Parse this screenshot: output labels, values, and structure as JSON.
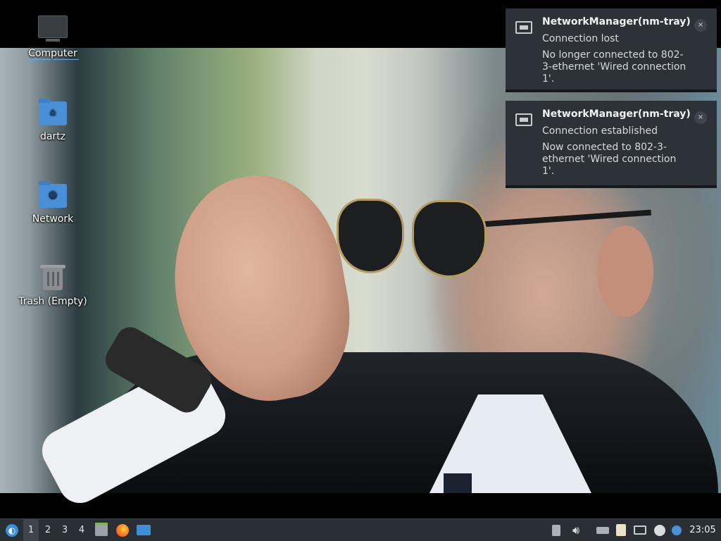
{
  "desktop": {
    "icons": [
      {
        "label": "Computer",
        "icon": "computer-icon"
      },
      {
        "label": "dartz",
        "icon": "home-folder-icon"
      },
      {
        "label": "Network",
        "icon": "network-folder-icon"
      },
      {
        "label": "Trash (Empty)",
        "icon": "trash-icon"
      }
    ]
  },
  "notifications": [
    {
      "app": "NetworkManager(nm-tray)",
      "summary": "Connection lost",
      "body": "No longer connected to 802-3-ethernet 'Wired connection 1'.",
      "close": "×",
      "icon": "network-wired-icon"
    },
    {
      "app": "NetworkManager(nm-tray)",
      "summary": "Connection established",
      "body": "Now connected to 802-3-ethernet 'Wired connection 1'.",
      "close": "×",
      "icon": "network-wired-icon"
    }
  ],
  "taskbar": {
    "desktops": [
      "1",
      "2",
      "3",
      "4"
    ],
    "active_desktop": "1",
    "quicklaunch": [
      "file-manager-icon",
      "firefox-icon",
      "show-desktop-icon"
    ],
    "tray": [
      "removable-drive-icon",
      "volume-icon",
      "keyboard-icon",
      "clipboard-icon",
      "network-wired-icon",
      "update-icon",
      "notification-icon"
    ],
    "clock": "23:05"
  },
  "colors": {
    "panel": "#2a2f35",
    "notification_bg": "#2d3238",
    "folder": "#4a90d9"
  }
}
